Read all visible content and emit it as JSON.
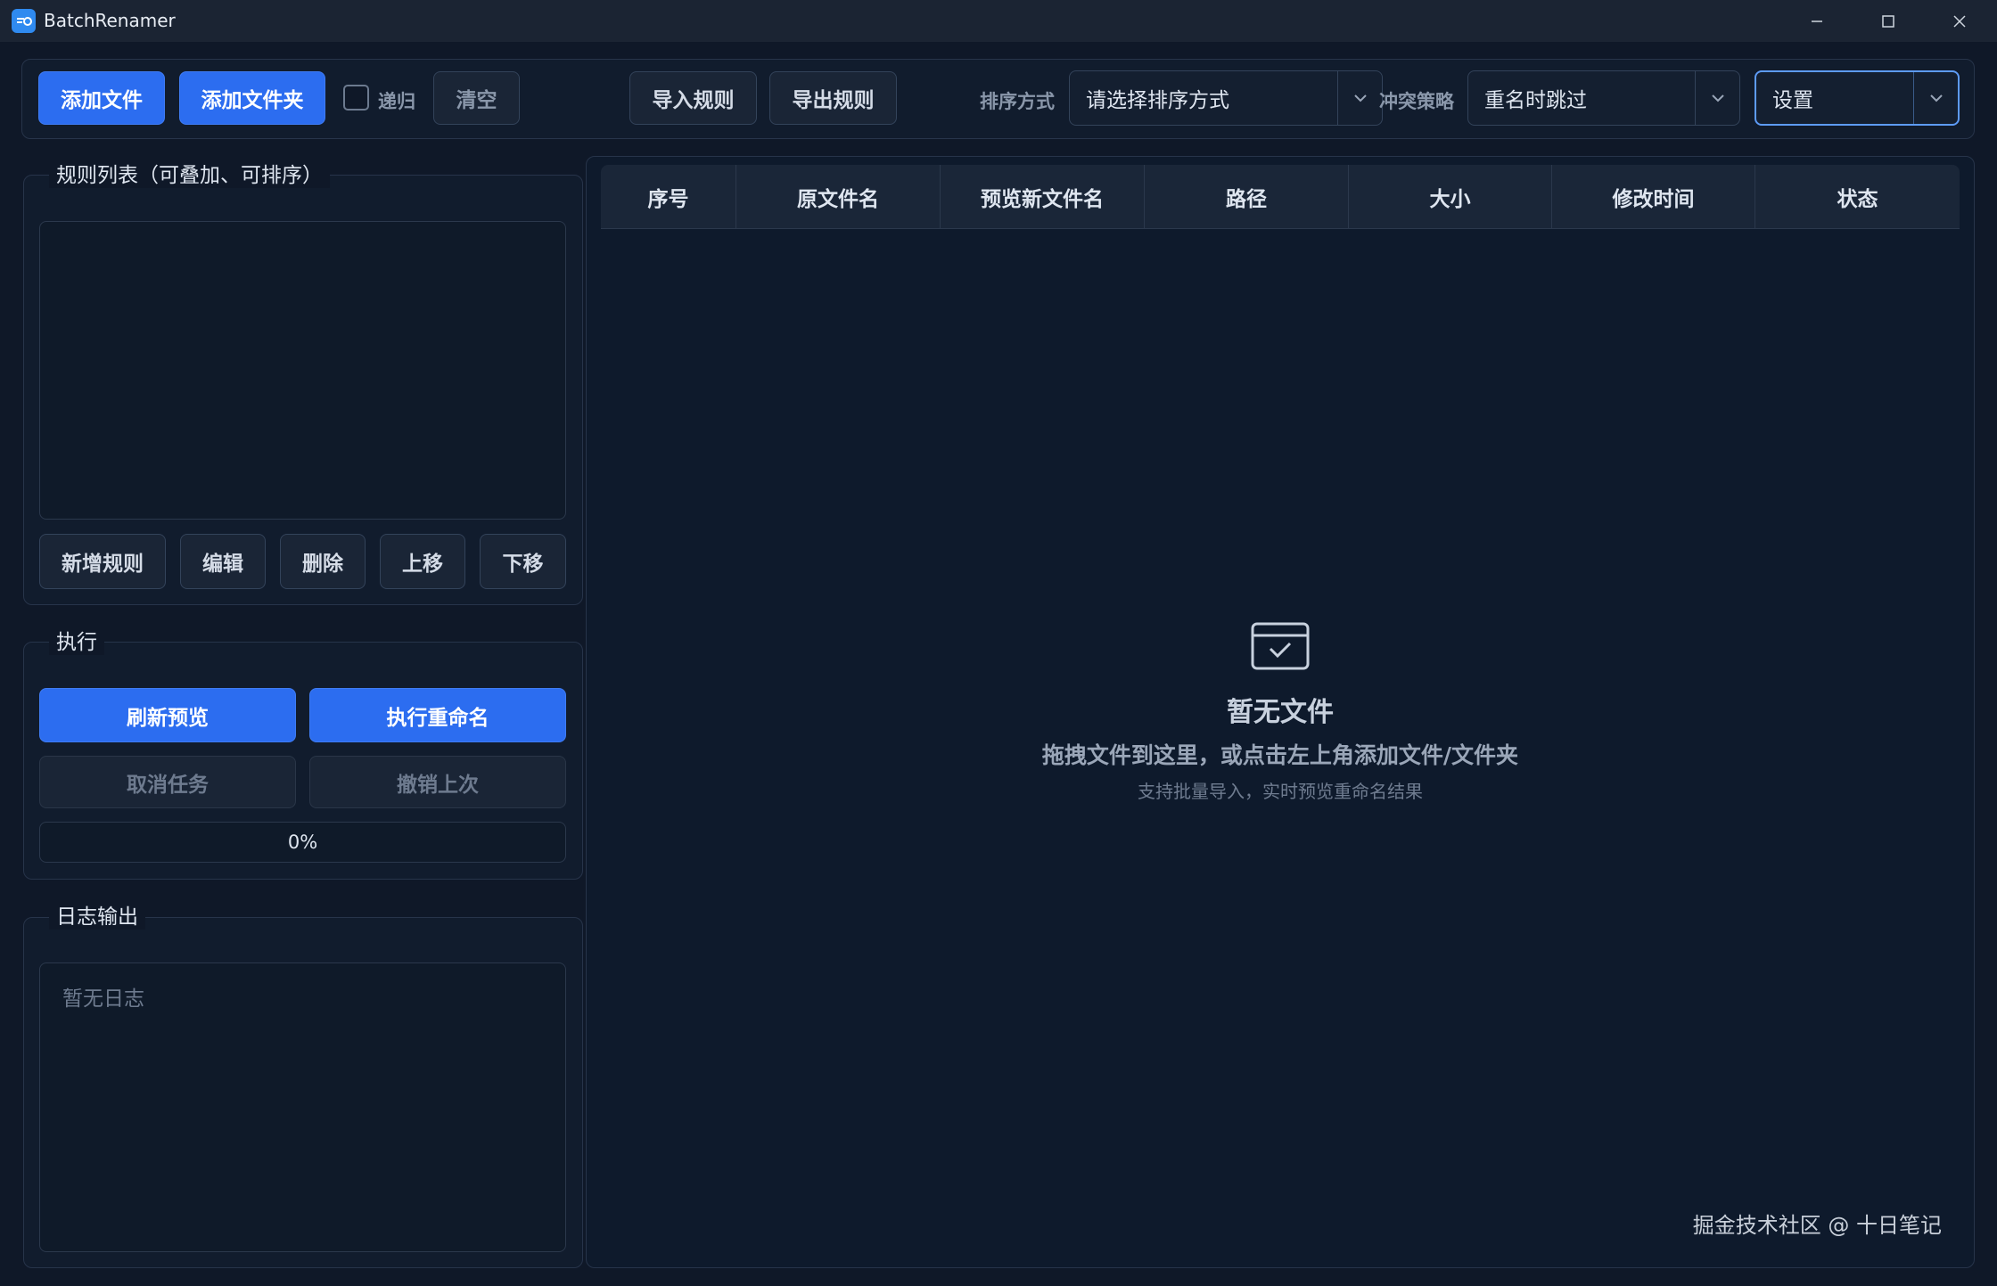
{
  "window": {
    "title": "BatchRenamer",
    "controls": [
      "minimize",
      "maximize",
      "close"
    ]
  },
  "toolbar": {
    "add_file": "添加文件",
    "add_folder": "添加文件夹",
    "recursive_label": "递归",
    "recursive_checked": false,
    "clear": "清空",
    "import_rules": "导入规则",
    "export_rules": "导出规则",
    "sort_label": "排序方式",
    "sort_value": "请选择排序方式",
    "conflict_label": "冲突策略",
    "conflict_value": "重名时跳过",
    "settings_value": "设置"
  },
  "rules": {
    "title": "规则列表（可叠加、可排序）",
    "buttons": {
      "add": "新增规则",
      "edit": "编辑",
      "delete": "删除",
      "move_up": "上移",
      "move_down": "下移"
    }
  },
  "execute": {
    "title": "执行",
    "refresh_preview": "刷新预览",
    "run_rename": "执行重命名",
    "cancel_task": "取消任务",
    "undo_last": "撤销上次",
    "progress_text": "0%",
    "progress_value": 0
  },
  "log": {
    "title": "日志输出",
    "placeholder": "暂无日志"
  },
  "table": {
    "columns": [
      "序号",
      "原文件名",
      "预览新文件名",
      "路径",
      "大小",
      "修改时间",
      "状态"
    ],
    "rows": [],
    "empty": {
      "title": "暂无文件",
      "subtitle": "拖拽文件到这里，或点击左上角添加文件/文件夹",
      "hint": "支持批量导入，实时预览重命名结果"
    }
  },
  "watermark": "掘金技术社区 @ 十日笔记",
  "colors": {
    "background": "#0f1828",
    "primary": "#2c6df0",
    "panel": "#111c2d",
    "border": "#27344a"
  }
}
